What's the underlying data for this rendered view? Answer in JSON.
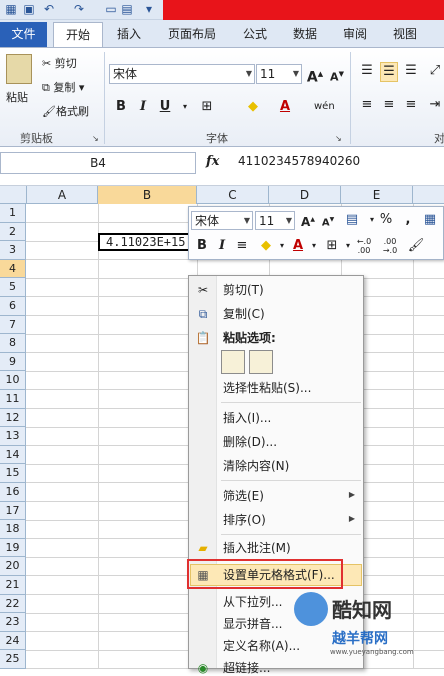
{
  "ribbon_tabs": {
    "file": "文件",
    "home": "开始",
    "insert": "插入",
    "layout": "页面布局",
    "formulas": "公式",
    "data": "数据",
    "review": "审阅",
    "view": "视图"
  },
  "clipboard": {
    "paste": "粘贴",
    "cut": "剪切",
    "copy": "复制",
    "format_painter": "格式刷",
    "group": "剪贴板"
  },
  "font": {
    "name": "宋体",
    "size": "11",
    "group": "字体",
    "grow": "A",
    "shrink": "A"
  },
  "alignment_group": "对",
  "formula_bar": {
    "name_box": "B4",
    "fx": "fx",
    "value": "4110234578940260"
  },
  "columns": [
    "A",
    "B",
    "C",
    "D",
    "E"
  ],
  "rows": [
    "1",
    "2",
    "3",
    "4",
    "5",
    "6",
    "7",
    "8",
    "9",
    "10",
    "11",
    "12",
    "13",
    "14",
    "15",
    "16",
    "17",
    "18",
    "19",
    "20",
    "21",
    "22",
    "23",
    "24",
    "25"
  ],
  "cell_b4": "4.11023E+15",
  "mini_toolbar": {
    "font": "宋体",
    "size": "11",
    "percent": "%",
    "comma": ",",
    "inc": "←.0\n.00",
    "dec": ".00\n→.0"
  },
  "context_menu": {
    "cut": "剪切(T)",
    "copy": "复制(C)",
    "paste_options": "粘贴选项:",
    "paste_special": "选择性粘贴(S)...",
    "insert": "插入(I)...",
    "delete": "删除(D)...",
    "clear": "清除内容(N)",
    "filter": "筛选(E)",
    "sort": "排序(O)",
    "insert_comment": "插入批注(M)",
    "format_cells": "设置单元格格式(F)...",
    "pick_list": "从下拉列...",
    "phonetic": "显示拼音...",
    "define_name": "定义名称(A)...",
    "hyperlink": "超链接..."
  },
  "watermark": {
    "name": "酷知网",
    "url": "www.yueyangbang.com",
    "cn": "越羊帮网"
  },
  "colors": {
    "file_tab": "#2a61b8",
    "title_red": "#e8141a",
    "highlight": "#fde8b6",
    "red_frame": "#e03030"
  }
}
